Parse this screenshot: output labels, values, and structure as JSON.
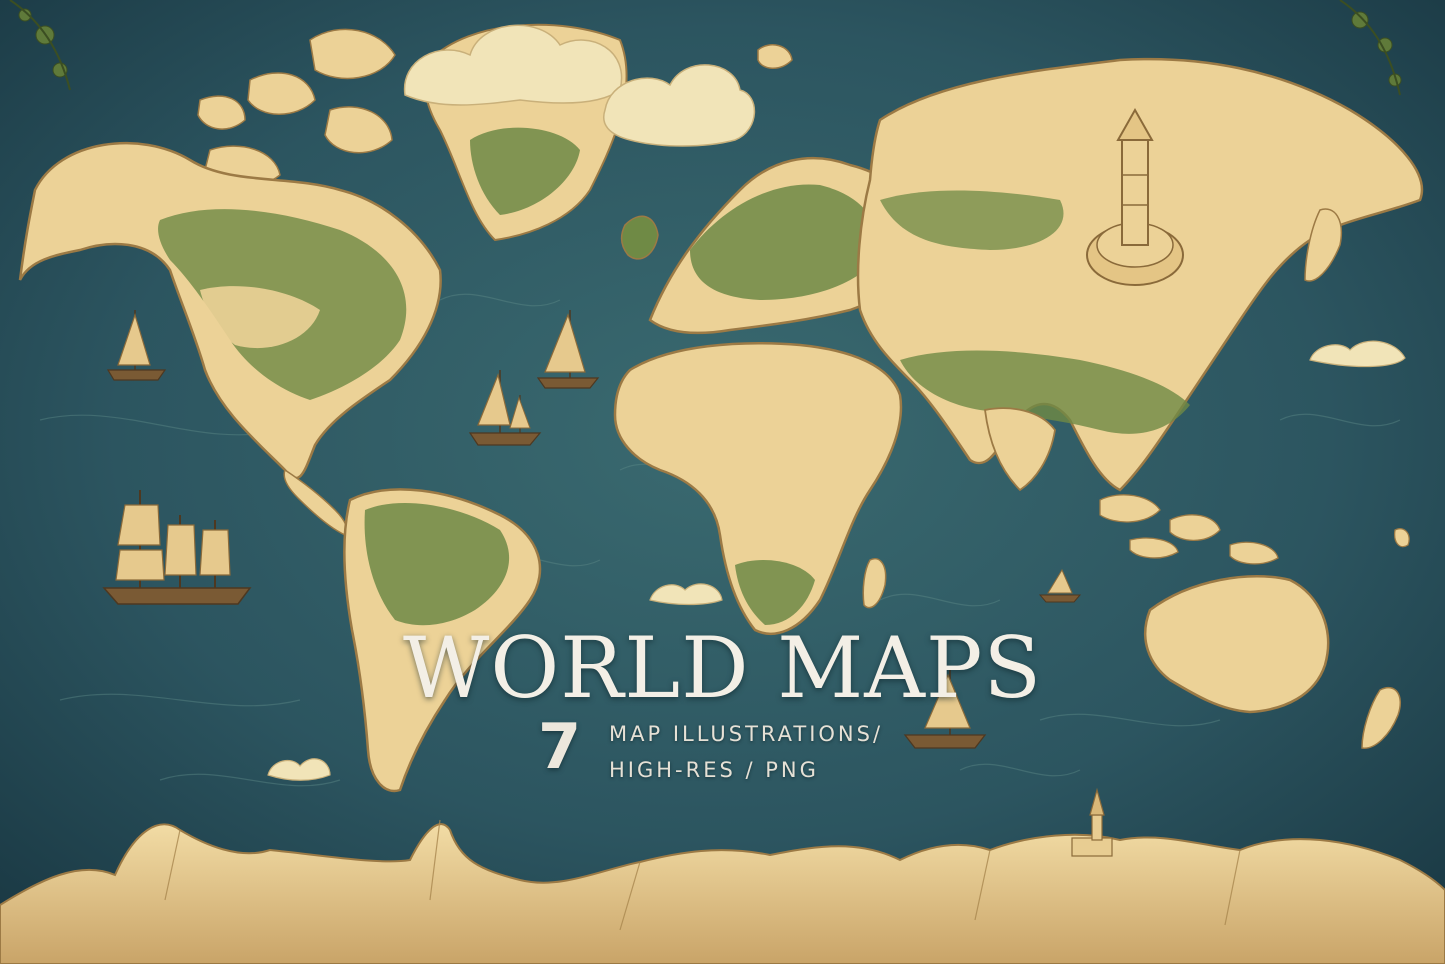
{
  "title": "WORLD MAPS",
  "count": "7",
  "subtitle_line1": "MAP ILLUSTRATIONS/",
  "subtitle_line2": "HIGH-RES / PNG",
  "colors": {
    "ocean": "#2c5560",
    "ocean_dark": "#1d3f4a",
    "land": "#ecd297",
    "land_edge": "#9c7a45",
    "forest": "#6f8a45",
    "cloud": "#f1e4b8",
    "sail": "#e6c98d",
    "title_text": "#f3efe6"
  },
  "icons": [
    "sailing-ship-icon",
    "cloud-icon",
    "tower-icon",
    "mountain-icon",
    "ornament-icon"
  ]
}
